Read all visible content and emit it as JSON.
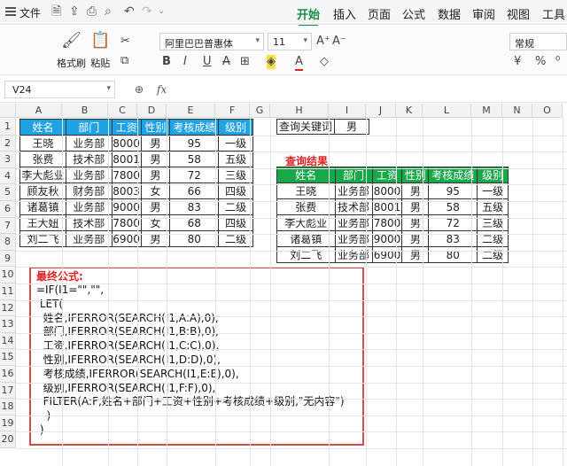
{
  "menubar": {
    "file_label": "文件",
    "tabs": [
      {
        "label": "开始",
        "active": true
      },
      {
        "label": "插入"
      },
      {
        "label": "页面"
      },
      {
        "label": "公式"
      },
      {
        "label": "数据"
      },
      {
        "label": "审阅"
      },
      {
        "label": "视图"
      },
      {
        "label": "工具"
      }
    ]
  },
  "ribbon": {
    "format_painter": "格式刷",
    "paste": "粘贴",
    "font_name": "阿里巴巴普惠体",
    "font_size": "11",
    "number_format": "常规"
  },
  "formula_bar": {
    "name_box": "V24",
    "fx": "fx",
    "formula": ""
  },
  "grid": {
    "columns": [
      "A",
      "B",
      "C",
      "D",
      "E",
      "F",
      "G",
      "H",
      "I",
      "J",
      "K",
      "L",
      "M",
      "N",
      "O"
    ],
    "rows": [
      "1",
      "2",
      "3",
      "4",
      "5",
      "6",
      "7",
      "8",
      "9",
      "10",
      "11",
      "12",
      "13",
      "14",
      "15",
      "16",
      "17",
      "18",
      "19",
      "20"
    ]
  },
  "source_table": {
    "headers": [
      "姓名",
      "部门",
      "工资",
      "性别",
      "考核成绩",
      "级别"
    ],
    "rows": [
      [
        "王晓",
        "业务部",
        "8000",
        "男",
        "95",
        "一级"
      ],
      [
        "张费",
        "技术部",
        "8001",
        "男",
        "58",
        "五级"
      ],
      [
        "李大彪业",
        "业务部",
        "7800",
        "男",
        "72",
        "三级"
      ],
      [
        "顾友秋",
        "财务部",
        "8003",
        "女",
        "66",
        "四级"
      ],
      [
        "诸葛镇",
        "业务部",
        "9000",
        "男",
        "83",
        "二级"
      ],
      [
        "王大妞",
        "技术部",
        "7800",
        "女",
        "68",
        "四级"
      ],
      [
        "刘二飞",
        "业务部",
        "6900",
        "男",
        "80",
        "二级"
      ]
    ]
  },
  "query": {
    "label": "查询关键词",
    "value": "男",
    "result_title": "查询结果"
  },
  "result_table": {
    "headers": [
      "姓名",
      "部门",
      "工资",
      "性别",
      "考核成绩",
      "级别"
    ],
    "rows": [
      [
        "王晓",
        "业务部",
        "8000",
        "男",
        "95",
        "一级"
      ],
      [
        "张费",
        "技术部",
        "8001",
        "男",
        "58",
        "五级"
      ],
      [
        "李大彪业",
        "业务部",
        "7800",
        "男",
        "72",
        "三级"
      ],
      [
        "诸葛镇",
        "业务部",
        "9000",
        "男",
        "83",
        "二级"
      ],
      [
        "刘二飞",
        "业务部",
        "6900",
        "男",
        "80",
        "二级"
      ]
    ]
  },
  "formula_note": {
    "title": "最终公式:",
    "lines": [
      "=IF(I1=\"\",\"\",",
      " LET(",
      "  姓名,IFERROR(SEARCH(I1,A:A),0),",
      "  部门,IFERROR(SEARCH(I1,B:B),0),",
      "  工资,IFERROR(SEARCH(I1,C:C),0),",
      "  性别,IFERROR(SEARCH(I1,D:D),0),",
      "  考核成绩,IFERROR(SEARCH(I1,E:E),0),",
      "  级别,IFERROR(SEARCH(I1,F:F),0),",
      "  FILTER(A:F,姓名+部门+工资+性别+考核成绩+级别,\"无内容\")",
      "   )",
      " )"
    ]
  },
  "colors": {
    "accent": "#1a8a4a",
    "source_header": "#1fa3e4",
    "result_header": "#18a84a",
    "highlight_red": "#e02020"
  }
}
